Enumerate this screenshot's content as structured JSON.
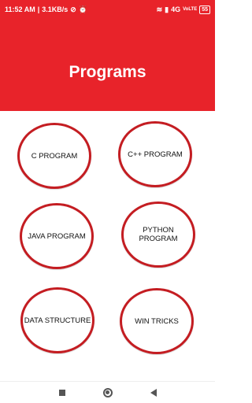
{
  "status_bar": {
    "time": "11:52 AM",
    "speed": "3.1KB/s",
    "network": "4G",
    "network_sub": "VoLTE",
    "battery": "55",
    "icons": [
      "mute-icon",
      "alarm-icon",
      "wifi-icon",
      "signal-icon"
    ]
  },
  "header": {
    "title": "Programs",
    "color": "#e8232a"
  },
  "programs": [
    {
      "label": "C PROGRAM"
    },
    {
      "label": "C++ PROGRAM"
    },
    {
      "label": "JAVA PROGRAM"
    },
    {
      "label": "PYTHON PROGRAM"
    },
    {
      "label": "DATA STRUCTURE"
    },
    {
      "label": "WIN TRICKS"
    }
  ],
  "nav": {
    "icons": [
      "recents-icon",
      "home-icon",
      "back-icon"
    ]
  }
}
